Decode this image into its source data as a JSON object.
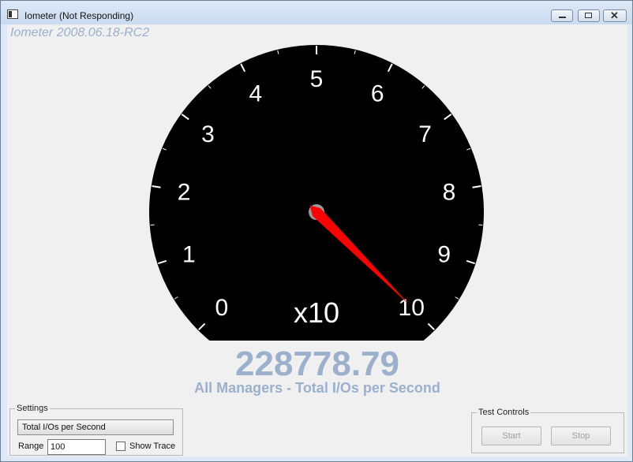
{
  "window": {
    "title": "Iometer (Not Responding)"
  },
  "version_label": "Iometer 2008.06.18-RC2",
  "gauge": {
    "scale_labels": [
      "0",
      "1",
      "2",
      "3",
      "4",
      "5",
      "6",
      "7",
      "8",
      "9",
      "10"
    ],
    "multiplier": "x10",
    "needle_value": 10,
    "range_max": 100
  },
  "reading": {
    "value": "228778.79",
    "caption": "All Managers - Total I/Os per Second"
  },
  "settings": {
    "legend": "Settings",
    "metric": "Total I/Os per Second",
    "range_label": "Range",
    "range_value": "100",
    "show_trace_label": "Show Trace",
    "show_trace_checked": false
  },
  "test_controls": {
    "legend": "Test Controls",
    "start_label": "Start",
    "stop_label": "Stop"
  },
  "colors": {
    "needle": "#ff0000",
    "dial": "#000000",
    "value_text": "#9ab0cc"
  }
}
